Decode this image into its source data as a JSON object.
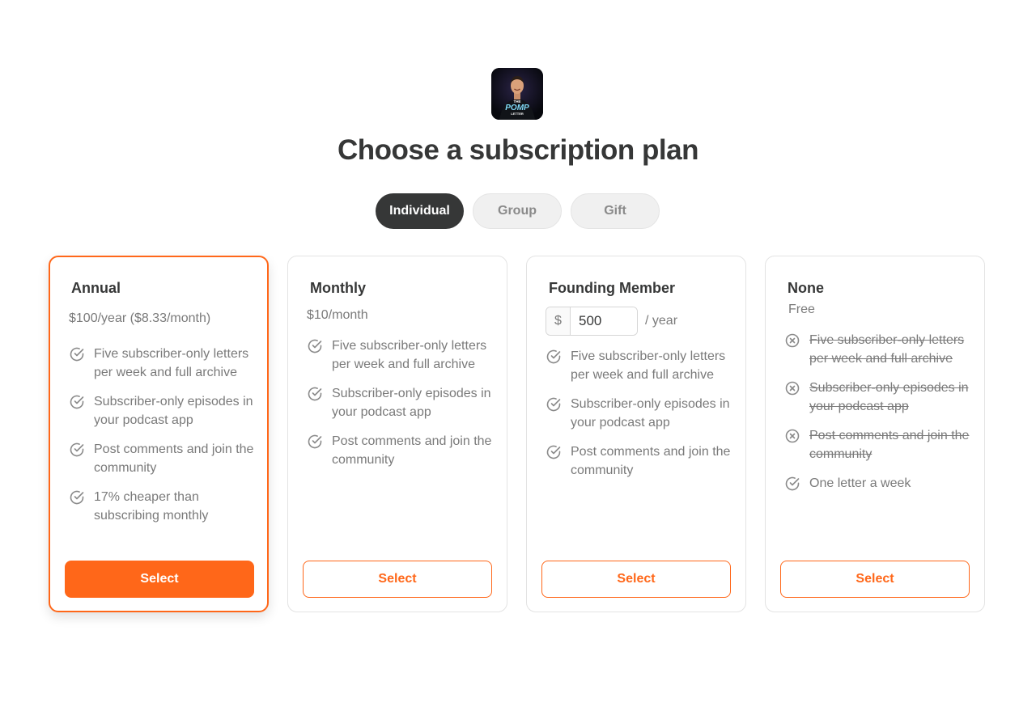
{
  "header": {
    "logo_text": [
      "THE",
      "POMP",
      "LETTER"
    ],
    "title": "Choose a subscription plan"
  },
  "tabs": [
    {
      "label": "Individual",
      "active": true
    },
    {
      "label": "Group",
      "active": false
    },
    {
      "label": "Gift",
      "active": false
    }
  ],
  "colors": {
    "accent": "#ff6719",
    "dark": "#363737",
    "muted": "#7a7a7a"
  },
  "plans": [
    {
      "name": "Annual",
      "price": "$100/year ($8.33/month)",
      "featured": true,
      "features": [
        {
          "icon": "check-circle-icon",
          "text": "Five subscriber-only letters per week and full archive",
          "included": true
        },
        {
          "icon": "check-circle-icon",
          "text": "Subscriber-only episodes in your podcast app",
          "included": true
        },
        {
          "icon": "check-circle-icon",
          "text": "Post comments and join the community",
          "included": true
        },
        {
          "icon": "check-circle-icon",
          "text": "17% cheaper than subscribing monthly",
          "included": true
        }
      ],
      "button_label": "Select"
    },
    {
      "name": "Monthly",
      "price": "$10/month",
      "featured": false,
      "features": [
        {
          "icon": "check-circle-icon",
          "text": "Five subscriber-only letters per week and full archive",
          "included": true
        },
        {
          "icon": "check-circle-icon",
          "text": "Subscriber-only episodes in your podcast app",
          "included": true
        },
        {
          "icon": "check-circle-icon",
          "text": "Post comments and join the community",
          "included": true
        }
      ],
      "button_label": "Select"
    },
    {
      "name": "Founding Member",
      "currency": "$",
      "amount": "500",
      "period": "/ year",
      "featured": false,
      "features": [
        {
          "icon": "check-circle-icon",
          "text": "Five subscriber-only letters per week and full archive",
          "included": true
        },
        {
          "icon": "check-circle-icon",
          "text": "Subscriber-only episodes in your podcast app",
          "included": true
        },
        {
          "icon": "check-circle-icon",
          "text": "Post comments and join the community",
          "included": true
        }
      ],
      "button_label": "Select"
    },
    {
      "name": "None",
      "price": "Free",
      "featured": false,
      "features": [
        {
          "icon": "x-circle-icon",
          "text": "Five subscriber-only letters per week and full archive",
          "included": false
        },
        {
          "icon": "x-circle-icon",
          "text": "Subscriber-only episodes in your podcast app",
          "included": false
        },
        {
          "icon": "x-circle-icon",
          "text": "Post comments and join the community",
          "included": false
        },
        {
          "icon": "check-circle-icon",
          "text": "One letter a week",
          "included": true
        }
      ],
      "button_label": "Select"
    }
  ]
}
